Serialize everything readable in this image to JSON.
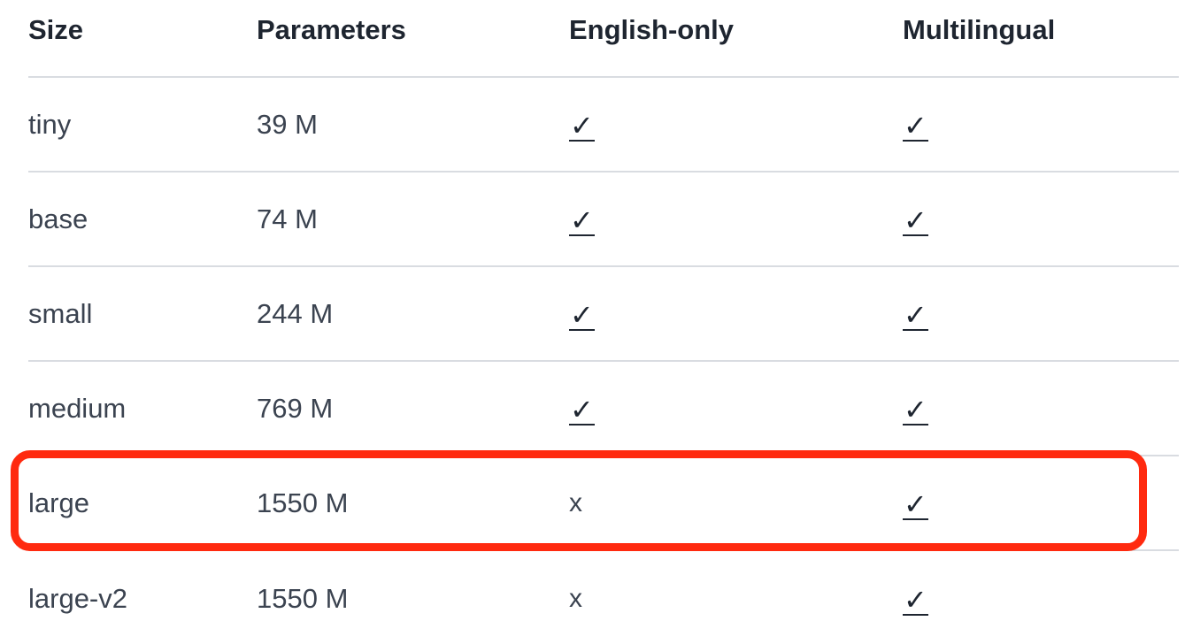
{
  "table": {
    "headers": [
      "Size",
      "Parameters",
      "English-only",
      "Multilingual"
    ],
    "rows": [
      {
        "size": "tiny",
        "parameters": "39 M",
        "english_only": "✓",
        "multilingual": "✓"
      },
      {
        "size": "base",
        "parameters": "74 M",
        "english_only": "✓",
        "multilingual": "✓"
      },
      {
        "size": "small",
        "parameters": "244 M",
        "english_only": "✓",
        "multilingual": "✓"
      },
      {
        "size": "medium",
        "parameters": "769 M",
        "english_only": "✓",
        "multilingual": "✓"
      },
      {
        "size": "large",
        "parameters": "1550 M",
        "english_only": "x",
        "multilingual": "✓"
      },
      {
        "size": "large-v2",
        "parameters": "1550 M",
        "english_only": "x",
        "multilingual": "✓"
      }
    ],
    "highlighted_row": "large"
  },
  "colors": {
    "highlight_border": "#ff2a0f",
    "row_divider": "#d9dce1",
    "text": "#3b4350",
    "header_text": "#1e2530"
  }
}
